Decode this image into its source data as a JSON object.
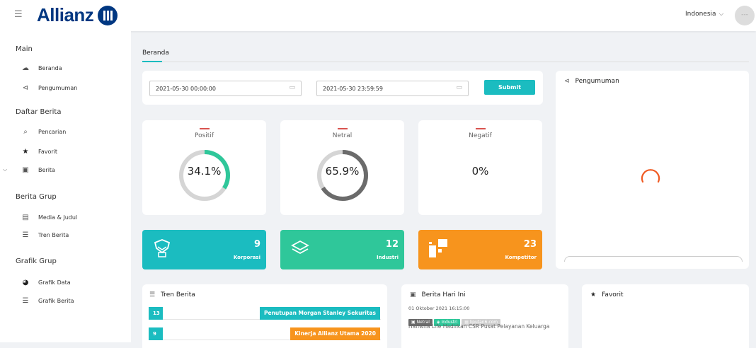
{
  "header": {
    "logo_text": "Allianz",
    "language": "Indonesia",
    "avatar_text": "---"
  },
  "sidebar": {
    "sections": [
      {
        "title": "Main",
        "items": [
          {
            "label": "Beranda",
            "icon": "cloud-icon"
          },
          {
            "label": "Pengumuman",
            "icon": "megaphone-icon"
          }
        ]
      },
      {
        "title": "Daftar Berita",
        "items": [
          {
            "label": "Pencarian",
            "icon": "search-icon"
          },
          {
            "label": "Favorit",
            "icon": "star-icon"
          },
          {
            "label": "Berita",
            "icon": "monitor-icon"
          }
        ]
      },
      {
        "title": "Berita Grup",
        "items": [
          {
            "label": "Media & Judul",
            "icon": "document-icon"
          },
          {
            "label": "Tren Berita",
            "icon": "list-icon"
          }
        ]
      },
      {
        "title": "Grafik Grup",
        "items": [
          {
            "label": "Grafik Data",
            "icon": "pie-chart-icon"
          },
          {
            "label": "Grafik Berita",
            "icon": "bar-chart-icon"
          }
        ]
      }
    ]
  },
  "breadcrumb": {
    "tab": "Beranda"
  },
  "filter": {
    "start_date": "2021-05-30 00:00:00",
    "end_date": "2021-05-30 23:59:59",
    "submit_label": "Submit"
  },
  "sentiment": [
    {
      "label": "Positif",
      "value": "34.1%",
      "fraction": 0.341,
      "color": "#2fc79a"
    },
    {
      "label": "Netral",
      "value": "65.9%",
      "fraction": 0.659,
      "color": "#6b6b6b"
    },
    {
      "label": "Negatif",
      "value": "0%",
      "fraction": 0,
      "color": "#d9534f"
    }
  ],
  "stats": [
    {
      "value": "9",
      "label": "Korporasi",
      "color": "#1bbcc0",
      "icon": "handshake-icon"
    },
    {
      "value": "12",
      "label": "Industri",
      "color": "#2fc79a",
      "icon": "layers-icon"
    },
    {
      "value": "23",
      "label": "Kompetitor",
      "color": "#f7941d",
      "icon": "blocks-icon"
    }
  ],
  "announcement": {
    "title": "Pengumuman"
  },
  "trend": {
    "title": "Tren Berita",
    "rows": [
      {
        "count": "13",
        "label": "Penutupan Morgan Stanley Sekuritas",
        "color": "#1bbcc0"
      },
      {
        "count": "9",
        "label": "Kinerja Allianz Utama 2020",
        "color": "#f7941d"
      }
    ]
  },
  "today_news": {
    "title": "Berita Hari Ini",
    "timestamp": "01 Oktober 2021 16:15:00",
    "tags": [
      {
        "label": "Netral",
        "color": "#6b6b6b"
      },
      {
        "label": "Industri",
        "color": "#2fc79a"
      },
      {
        "label": "liputan6.com",
        "color": "#cfcfcf"
      }
    ],
    "headline": "Hanwha Life Hadirkan CSR Pusat Pelayanan Keluarga"
  },
  "favorite": {
    "title": "Favorit"
  }
}
